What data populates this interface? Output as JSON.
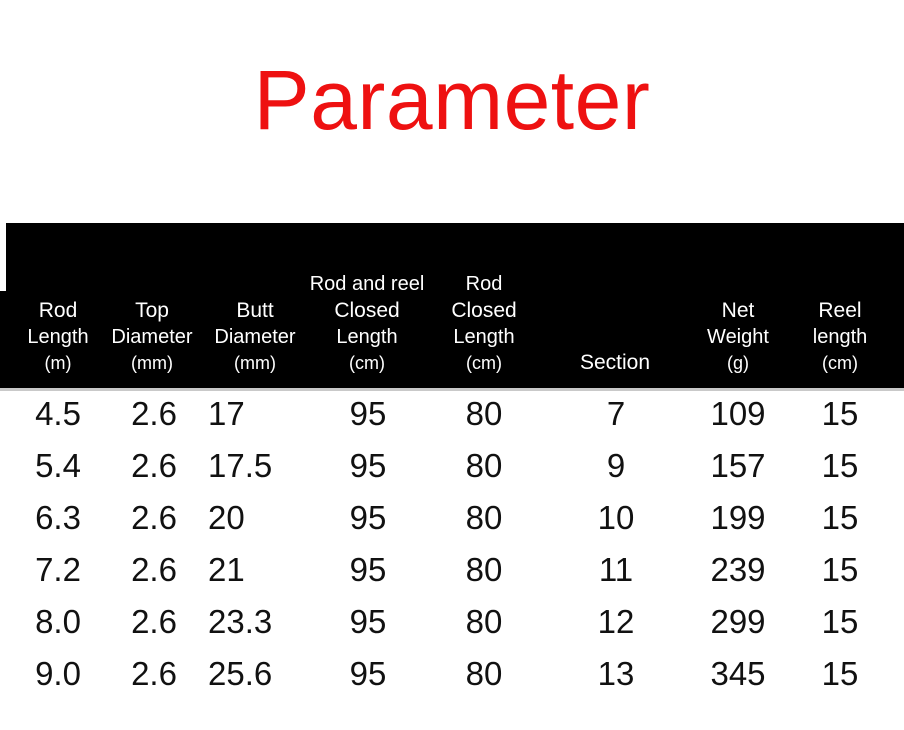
{
  "title": "Parameter",
  "title_color": "#ee1111",
  "header_background": "#000000",
  "header_text_color": "#ffffff",
  "columns": [
    {
      "pre": "",
      "main": "Rod",
      "sub": "Length",
      "unit": "(m)"
    },
    {
      "pre": "",
      "main": "Top",
      "sub": "Diameter",
      "unit": "(mm)"
    },
    {
      "pre": "",
      "main": "Butt",
      "sub": "Diameter",
      "unit": "(mm)"
    },
    {
      "pre": "Rod and reel",
      "main": "Closed",
      "sub": "Length",
      "unit": "(cm)"
    },
    {
      "pre": "Rod",
      "main": "Closed",
      "sub": "Length",
      "unit": "(cm)"
    },
    {
      "pre": "",
      "main": "Section",
      "sub": "",
      "unit": ""
    },
    {
      "pre": "",
      "main": "Net",
      "sub": "Weight",
      "unit": "(g)"
    },
    {
      "pre": "",
      "main": "Reel",
      "sub": "length",
      "unit": "(cm)"
    }
  ],
  "rows": [
    {
      "rod_length": "4.5",
      "top_diameter": "2.6",
      "butt_diameter": "17",
      "rod_reel_closed_length": "95",
      "rod_closed_length": "80",
      "section": "7",
      "net_weight": "109",
      "reel_length": "15"
    },
    {
      "rod_length": "5.4",
      "top_diameter": "2.6",
      "butt_diameter": "17.5",
      "rod_reel_closed_length": "95",
      "rod_closed_length": "80",
      "section": "9",
      "net_weight": "157",
      "reel_length": "15"
    },
    {
      "rod_length": "6.3",
      "top_diameter": "2.6",
      "butt_diameter": "20",
      "rod_reel_closed_length": "95",
      "rod_closed_length": "80",
      "section": "10",
      "net_weight": "199",
      "reel_length": "15"
    },
    {
      "rod_length": "7.2",
      "top_diameter": "2.6",
      "butt_diameter": "21",
      "rod_reel_closed_length": "95",
      "rod_closed_length": "80",
      "section": "11",
      "net_weight": "239",
      "reel_length": "15"
    },
    {
      "rod_length": "8.0",
      "top_diameter": "2.6",
      "butt_diameter": "23.3",
      "rod_reel_closed_length": "95",
      "rod_closed_length": "80",
      "section": "12",
      "net_weight": "299",
      "reel_length": "15"
    },
    {
      "rod_length": "9.0",
      "top_diameter": "2.6",
      "butt_diameter": "25.6",
      "rod_reel_closed_length": "95",
      "rod_closed_length": "80",
      "section": "13",
      "net_weight": "345",
      "reel_length": "15"
    }
  ]
}
